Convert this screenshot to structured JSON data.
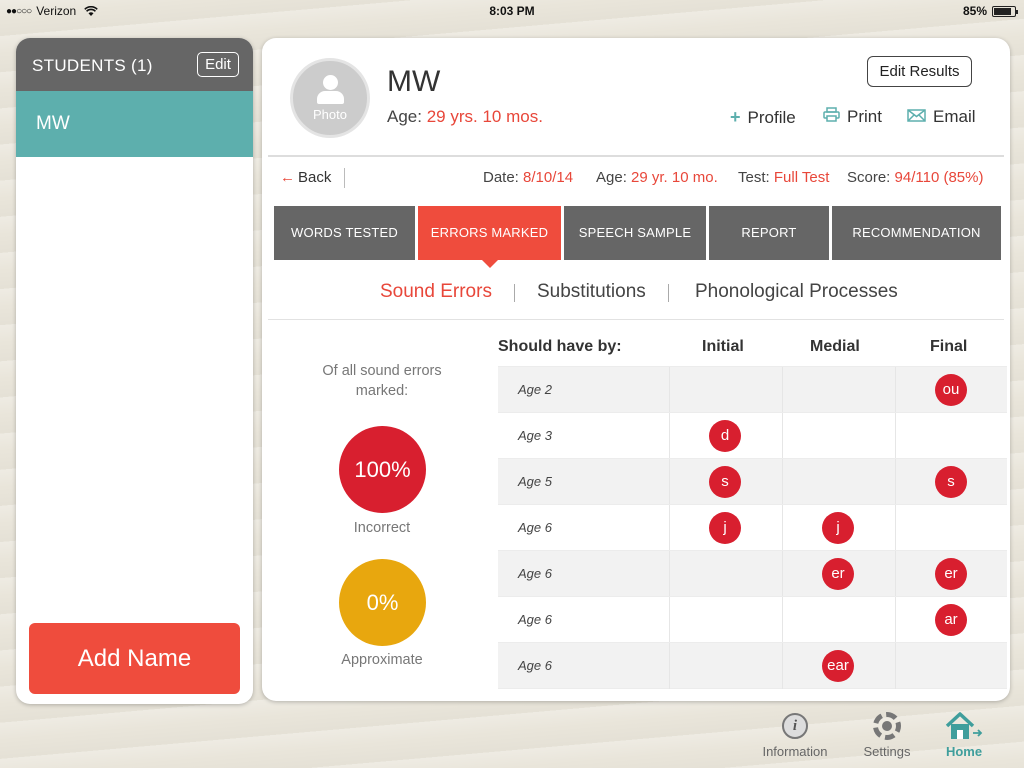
{
  "status_bar": {
    "carrier": "Verizon",
    "signal_dots": "●●○○○",
    "time": "8:03 PM",
    "battery": "85%"
  },
  "sidebar": {
    "title": "STUDENTS (1)",
    "edit_label": "Edit",
    "students": [
      {
        "name": "MW"
      }
    ],
    "add_name_label": "Add Name"
  },
  "profile": {
    "photo_label": "Photo",
    "name": "MW",
    "age_label": "Age:",
    "age_value": "29 yrs. 10 mos.",
    "edit_results_label": "Edit Results",
    "actions": {
      "profile": "Profile",
      "print": "Print",
      "email": "Email"
    }
  },
  "test_info": {
    "back_label": "Back",
    "date_label": "Date:",
    "date_value": "8/10/14",
    "age_label": "Age:",
    "age_value": "29 yr. 10 mo.",
    "test_label": "Test:",
    "test_value": "Full Test",
    "score_label": "Score:",
    "score_value": "94/110 (85%)"
  },
  "tabs": [
    "WORDS TESTED",
    "ERRORS MARKED",
    "SPEECH SAMPLE",
    "REPORT",
    "RECOMMENDATION"
  ],
  "active_tab": "ERRORS MARKED",
  "subtabs": [
    "Sound Errors",
    "Substitutions",
    "Phonological Processes"
  ],
  "active_subtab": "Sound Errors",
  "stats": {
    "caption": "Of all sound errors marked:",
    "incorrect_value": "100%",
    "incorrect_label": "Incorrect",
    "approximate_value": "0%",
    "approximate_label": "Approximate"
  },
  "table": {
    "headers": [
      "Should have by:",
      "Initial",
      "Medial",
      "Final"
    ],
    "rows": [
      {
        "age": "Age 2",
        "initial": "",
        "medial": "",
        "final": "ou"
      },
      {
        "age": "Age 3",
        "initial": "d",
        "medial": "",
        "final": ""
      },
      {
        "age": "Age 5",
        "initial": "s",
        "medial": "",
        "final": "s"
      },
      {
        "age": "Age 6",
        "initial": "j",
        "medial": "j",
        "final": ""
      },
      {
        "age": "Age 6",
        "initial": "",
        "medial": "er",
        "final": "er"
      },
      {
        "age": "Age 6",
        "initial": "",
        "medial": "",
        "final": "ar"
      },
      {
        "age": "Age 6",
        "initial": "",
        "medial": "ear",
        "final": ""
      }
    ]
  },
  "bottom_bar": {
    "information": "Information",
    "settings": "Settings",
    "home": "Home"
  },
  "colors": {
    "accent_red": "#ef4c3d",
    "teal": "#5dafad",
    "chip_red": "#d81f2f",
    "approx_yellow": "#e8a70e"
  }
}
